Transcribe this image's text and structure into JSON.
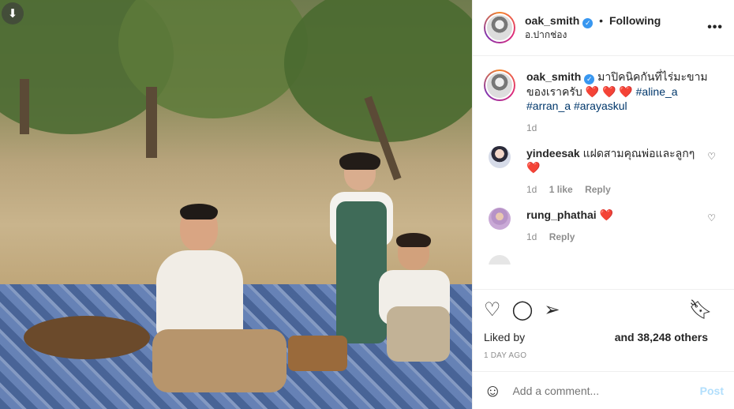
{
  "header": {
    "username": "oak_smith",
    "separator": "•",
    "follow_status": "Following",
    "location": "อ.ปากช่อง"
  },
  "caption": {
    "username": "oak_smith",
    "text": "มาปิคนิคกันที่ไร่มะขามของเราครับ",
    "hearts": "❤️ ❤️ ❤️",
    "hashtags": [
      "#aline_a",
      "#arran_a",
      "#arayaskul"
    ],
    "time": "1d"
  },
  "comments": [
    {
      "username": "yindeesak",
      "text": "แฝดสามคุณพ่อและลูกๆ",
      "heart": "❤️",
      "time": "1d",
      "likes": "1 like",
      "reply_label": "Reply"
    },
    {
      "username": "rung_phathai",
      "text": "",
      "heart": "❤️",
      "time": "1d",
      "likes": "",
      "reply_label": "Reply"
    }
  ],
  "actions": {
    "liked_by_label": "Liked by",
    "others": "and 38,248 others",
    "date": "1 DAY AGO"
  },
  "add_comment": {
    "placeholder": "Add a comment...",
    "post_label": "Post"
  },
  "icons": {
    "download": "download-icon",
    "more": "more-options-icon",
    "like": "heart-icon",
    "comment": "comment-icon",
    "share": "share-icon",
    "save": "bookmark-icon",
    "emoji": "emoji-icon"
  },
  "colors": {
    "verified": "#3897f0",
    "heart": "#ed4956",
    "hashtag": "#00376b",
    "post_disabled": "#b2dffc"
  }
}
